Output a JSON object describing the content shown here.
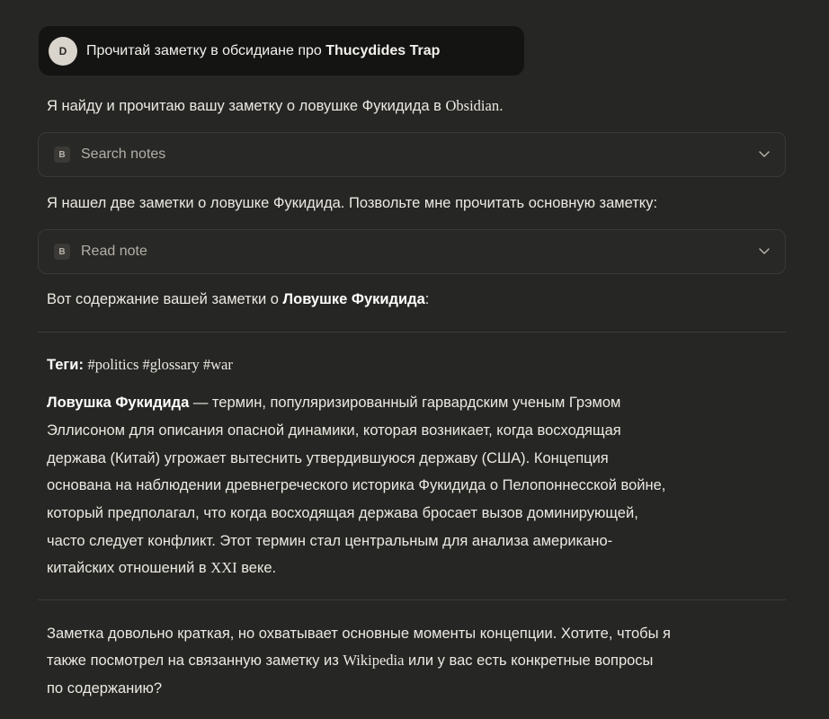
{
  "user_message": {
    "avatar_letter": "D",
    "text_before": "Прочитай заметку в обсидиане про ",
    "text_bold": "Thucydides Trap"
  },
  "reply_intro": {
    "text": "Я найду и прочитаю вашу заметку о ловушке Фукидида в ",
    "app_name": "Obsidian",
    "end": "."
  },
  "tool_calls": [
    {
      "badge": "B",
      "label": "Search notes",
      "icon": "chevron-down-icon"
    },
    {
      "badge": "B",
      "label": "Read note",
      "icon": "chevron-down-icon"
    }
  ],
  "found_text": "Я нашел две заметки о ловушке Фукидида. Позвольте мне прочитать основную заметку:",
  "content_intro": {
    "before": "Вот содержание вашей заметки о ",
    "bold": "Ловушке Фукидида",
    "after": ":"
  },
  "tags": {
    "label": "Теги:",
    "values": "#politics #glossary #war"
  },
  "note_body": {
    "term": "Ловушка Фукидида",
    "lines": [
      " — термин, популяризированный гарвардским ученым Грэмом",
      "Эллисоном для описания опасной динамики, которая возникает, когда восходящая",
      "держава (Китай) угрожает вытеснить утвердившуюся державу (США). Концепция",
      "основана на наблюдении древнегреческого историка Фукидида о Пелопоннесской войне,",
      "который предполагал, что когда восходящая держава бросает вызов доминирующей,",
      "часто следует конфликт. Этот термин стал центральным для анализа американо-"
    ],
    "last_line_before": "китайских отношений в ",
    "century": "XXI",
    "last_line_after": " веке."
  },
  "closing": {
    "line1": "Заметка довольно краткая, но охватывает основные моменты концепции. Хотите, чтобы я",
    "line2_before": "также посмотрел на связанную заметку из ",
    "line2_source": "Wikipedia",
    "line2_after": " или у вас есть конкретные вопросы",
    "line3": "по содержанию?"
  }
}
